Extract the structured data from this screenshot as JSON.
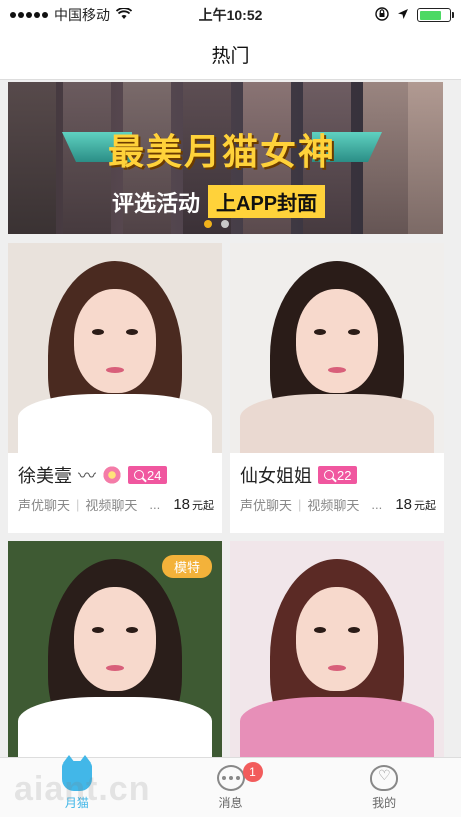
{
  "status_bar": {
    "carrier": "中国移动",
    "time": "上午10:52",
    "battery_level": 0.75
  },
  "header": {
    "title": "热门"
  },
  "banner": {
    "title": "最美月猫女神",
    "subtitle_a": "评选活动",
    "subtitle_b": "上APP封面",
    "dot_count": 2,
    "active_dot": 0
  },
  "cards": [
    {
      "name": "徐美壹",
      "name_deco": "〰",
      "has_flower": true,
      "fans": "24",
      "tags": [
        "声优聊天",
        "视频聊天",
        "..."
      ],
      "price": "18",
      "price_unit": "元起",
      "badge": "",
      "colors": {
        "bg": "#e9e2dc",
        "hair": "#4a2a20",
        "clothes": "#ffffff"
      }
    },
    {
      "name": "仙女姐姐",
      "name_deco": "",
      "has_flower": false,
      "fans": "22",
      "tags": [
        "声优聊天",
        "视频聊天",
        "..."
      ],
      "price": "18",
      "price_unit": "元起",
      "badge": "",
      "colors": {
        "bg": "#f0eeec",
        "hair": "#2a1c18",
        "clothes": "#ead9d1"
      }
    },
    {
      "name": "",
      "badge": "模特",
      "colors": {
        "bg": "#3e5a33",
        "hair": "#2a1e1a",
        "clothes": "#ffffff"
      }
    },
    {
      "name": "",
      "badge": "",
      "colors": {
        "bg": "#f1e6ea",
        "hair": "#5b2a25",
        "clothes": "#e78fb8"
      }
    }
  ],
  "tab_bar": {
    "items": [
      {
        "label": "月猫",
        "icon": "cat-icon",
        "active": true
      },
      {
        "label": "消息",
        "icon": "message-icon",
        "badge": "1"
      },
      {
        "label": "我的",
        "icon": "heart-profile-icon"
      }
    ]
  },
  "watermark": "aiant.cn"
}
